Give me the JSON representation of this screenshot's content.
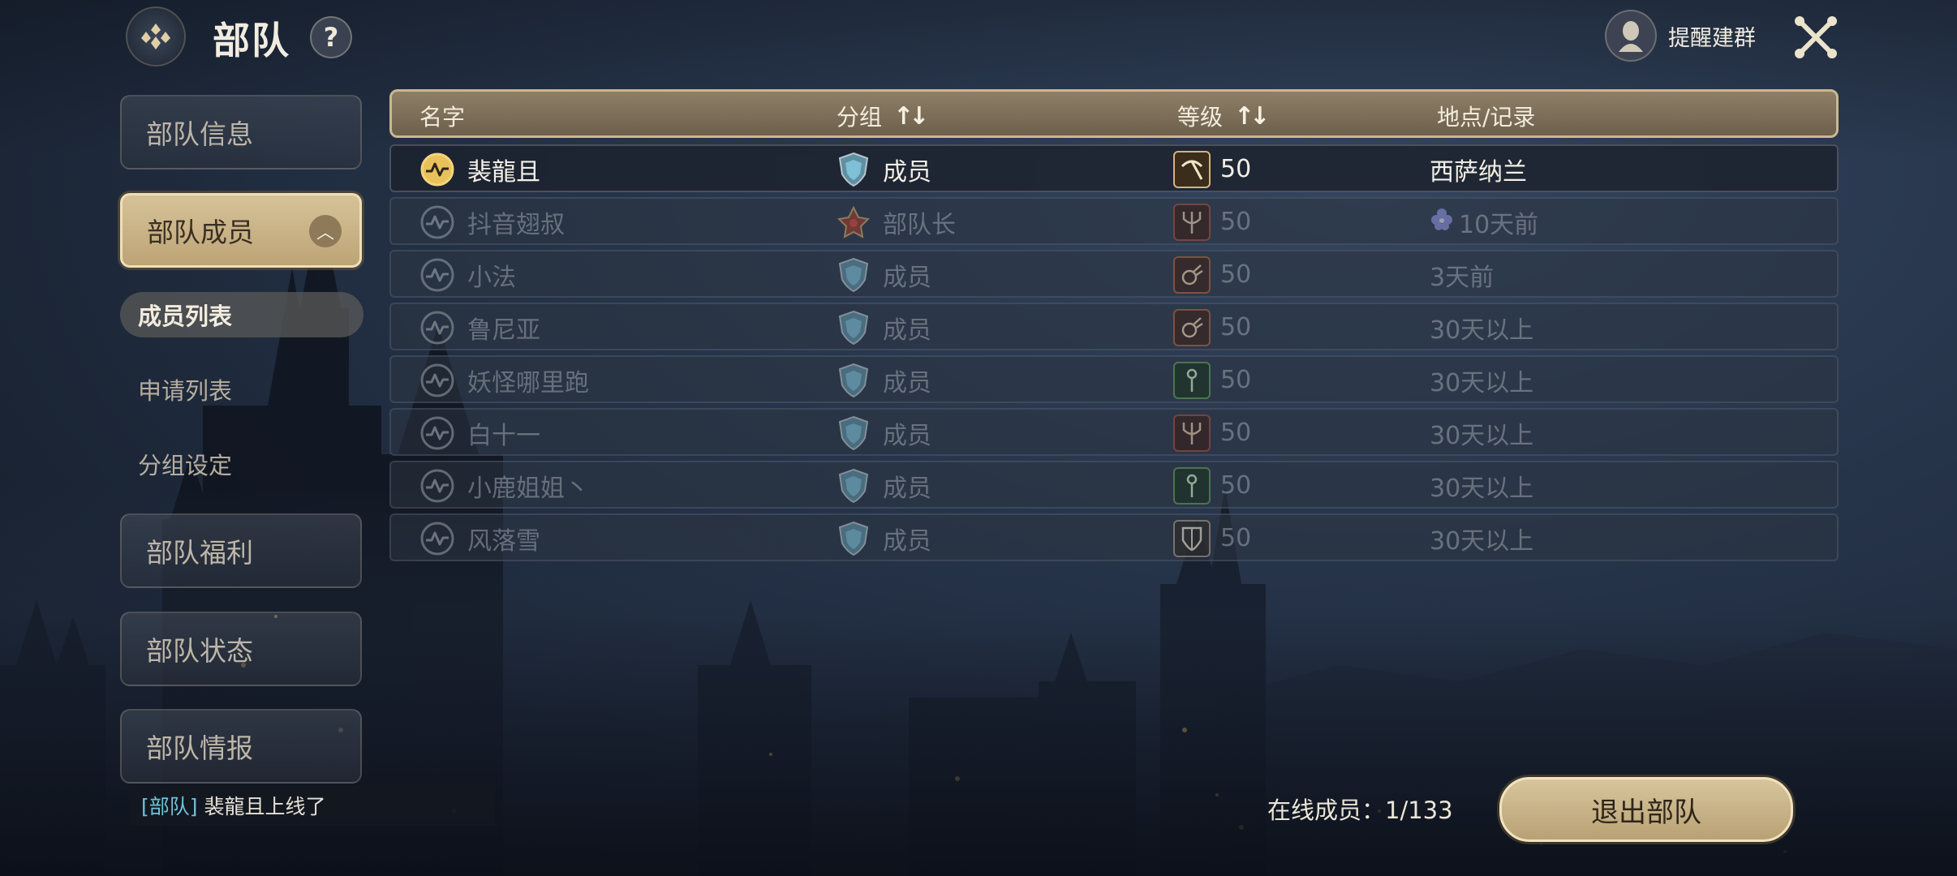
{
  "header": {
    "title": "部队",
    "help_label": "?",
    "remind_label": "提醒建群"
  },
  "sidebar": {
    "items": [
      {
        "label": "部队信息",
        "active": false
      },
      {
        "label": "部队成员",
        "active": true,
        "expanded": true
      },
      {
        "label": "部队福利",
        "active": false
      },
      {
        "label": "部队状态",
        "active": false
      },
      {
        "label": "部队情报",
        "active": false
      }
    ],
    "subitems": [
      {
        "label": "成员列表",
        "active": true
      },
      {
        "label": "申请列表",
        "active": false
      },
      {
        "label": "分组设定",
        "active": false
      }
    ]
  },
  "table": {
    "headers": {
      "name": "名字",
      "group": "分组",
      "level": "等级",
      "location": "地点/记录"
    },
    "rows": [
      {
        "name": "裴龍且",
        "group": "成员",
        "group_icon": "shield-icon",
        "class_icon": "pickaxe-icon",
        "level": "50",
        "location": "西萨纳兰",
        "online": true
      },
      {
        "name": "抖音翅叔",
        "group": "部队长",
        "group_icon": "leader-star-icon",
        "class_icon": "trident-icon",
        "level": "50",
        "location": "10天前",
        "location_icon": "flower-icon",
        "online": false
      },
      {
        "name": "小法",
        "group": "成员",
        "group_icon": "shield-icon",
        "class_icon": "fireball-icon",
        "level": "50",
        "location": "3天前",
        "online": false
      },
      {
        "name": "鲁尼亚",
        "group": "成员",
        "group_icon": "shield-icon",
        "class_icon": "fireball-icon",
        "level": "50",
        "location": "30天以上",
        "online": false
      },
      {
        "name": "妖怪哪里跑",
        "group": "成员",
        "group_icon": "shield-icon",
        "class_icon": "staff-icon",
        "level": "50",
        "location": "30天以上",
        "online": false
      },
      {
        "name": "白十一",
        "group": "成员",
        "group_icon": "shield-icon",
        "class_icon": "trident-icon",
        "level": "50",
        "location": "30天以上",
        "online": false
      },
      {
        "name": "小鹿姐姐丶",
        "group": "成员",
        "group_icon": "shield-icon",
        "class_icon": "staff-icon",
        "level": "50",
        "location": "30天以上",
        "online": false
      },
      {
        "name": "风落雪",
        "group": "成员",
        "group_icon": "shield-icon",
        "class_icon": "guard-shield-icon",
        "level": "50",
        "location": "30天以上",
        "online": false
      }
    ]
  },
  "footer": {
    "chat_tag": "[部队]",
    "chat_text": "裴龍且上线了",
    "online_count": "在线成员：1/133",
    "exit_label": "退出部队"
  },
  "colors": {
    "accent_gold": "#d7c298",
    "online_cyan": "#6fc2d8"
  }
}
